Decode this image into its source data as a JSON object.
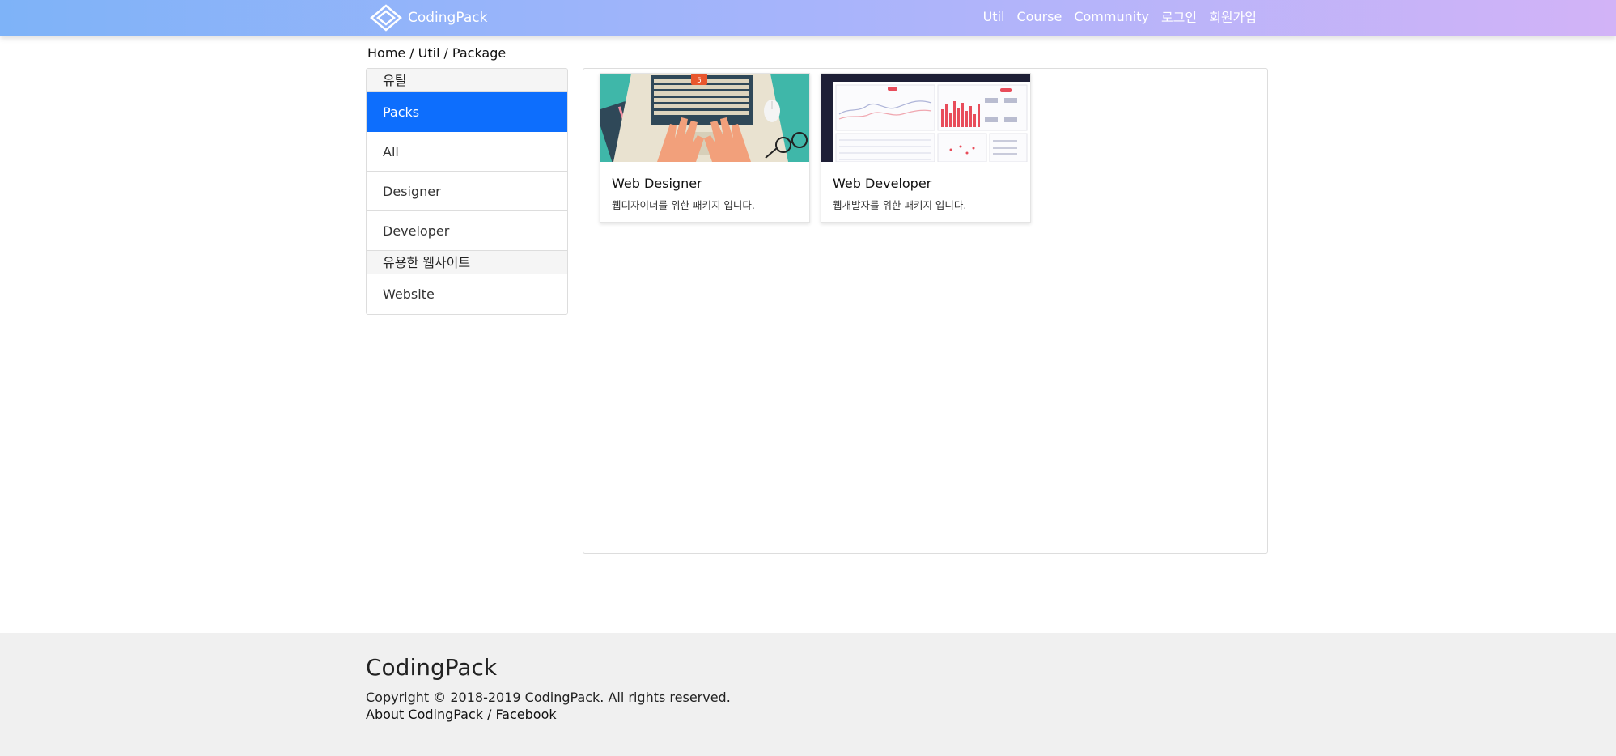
{
  "navbar": {
    "brand": "CodingPack",
    "links": [
      "Util",
      "Course",
      "Community",
      "로그인",
      "회원가입"
    ]
  },
  "breadcrumb": {
    "items": [
      "Home",
      "Util",
      "Package"
    ],
    "separator": "/"
  },
  "sidebar": {
    "section1_title": "유틸",
    "items": [
      "Packs",
      "All",
      "Designer",
      "Developer"
    ],
    "active_item": "Packs",
    "section2_title": "유용한 웹사이트",
    "section2_items": [
      "Website"
    ]
  },
  "cards": [
    {
      "title": "Web Designer",
      "description": "웹디자이너를 위한 패키지 입니다."
    },
    {
      "title": "Web Developer",
      "description": "웹개발자를 위한 패키지 입니다."
    }
  ],
  "footer": {
    "brand": "CodingPack",
    "copyright": "Copyright © 2018-2019 CodingPack. All rights reserved.",
    "links": [
      "About CodingPack",
      "Facebook"
    ],
    "separator": "/"
  },
  "colors": {
    "nav_gradient_start": "#7eb3f8",
    "nav_gradient_end": "#d2b3f7",
    "active_blue": "#0d6efd",
    "footer_bg": "#f0f0f0"
  }
}
